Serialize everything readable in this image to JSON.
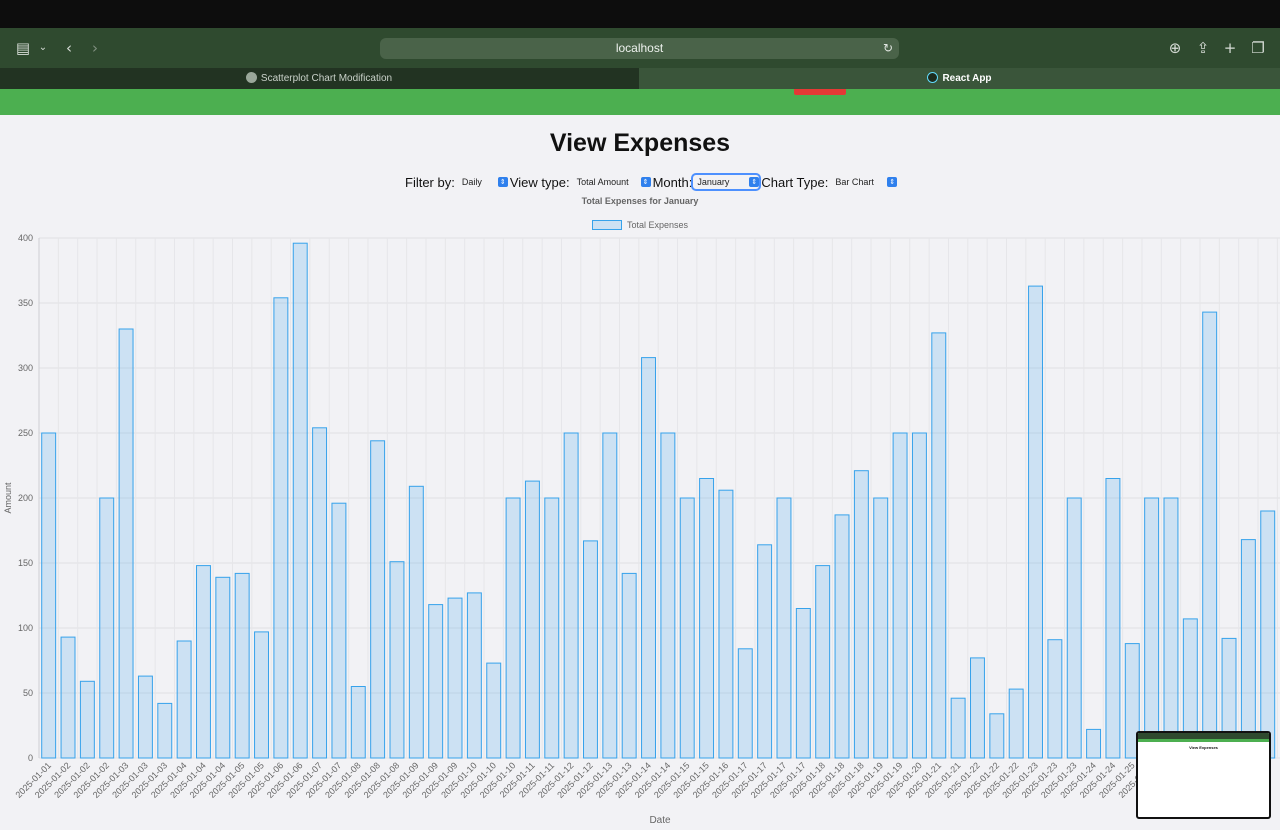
{
  "browser": {
    "url": "localhost",
    "tabs": [
      {
        "label": "Scatterplot Chart Modification",
        "active": false
      },
      {
        "label": "React App",
        "active": true
      }
    ]
  },
  "page": {
    "title": "View Expenses",
    "controls": {
      "filter_label": "Filter by:",
      "filter_value": "Daily",
      "view_label": "View type:",
      "view_value": "Total Amount",
      "month_label": "Month:",
      "month_value": "January",
      "chart_type_label": "Chart Type:",
      "chart_type_value": "Bar Chart"
    }
  },
  "chart_data": {
    "type": "bar",
    "title": "Total Expenses for January",
    "xlabel": "Date",
    "ylabel": "Amount",
    "ylim": [
      0,
      400
    ],
    "yticks": [
      0,
      50,
      100,
      150,
      200,
      250,
      300,
      350,
      400
    ],
    "grid": true,
    "legend_position": "top",
    "bar_color": "#36a2eb",
    "series": [
      {
        "name": "Total Expenses"
      }
    ],
    "categories": [
      "2025-01-01",
      "2025-01-02",
      "2025-01-02",
      "2025-01-02",
      "2025-01-03",
      "2025-01-03",
      "2025-01-03",
      "2025-01-04",
      "2025-01-04",
      "2025-01-04",
      "2025-01-05",
      "2025-01-05",
      "2025-01-06",
      "2025-01-06",
      "2025-01-07",
      "2025-01-07",
      "2025-01-08",
      "2025-01-08",
      "2025-01-08",
      "2025-01-09",
      "2025-01-09",
      "2025-01-09",
      "2025-01-10",
      "2025-01-10",
      "2025-01-10",
      "2025-01-11",
      "2025-01-11",
      "2025-01-12",
      "2025-01-12",
      "2025-01-13",
      "2025-01-13",
      "2025-01-14",
      "2025-01-14",
      "2025-01-15",
      "2025-01-15",
      "2025-01-16",
      "2025-01-17",
      "2025-01-17",
      "2025-01-17",
      "2025-01-17",
      "2025-01-18",
      "2025-01-18",
      "2025-01-18",
      "2025-01-19",
      "2025-01-19",
      "2025-01-20",
      "2025-01-21",
      "2025-01-21",
      "2025-01-22",
      "2025-01-22",
      "2025-01-22",
      "2025-01-23",
      "2025-01-23",
      "2025-01-23",
      "2025-01-24",
      "2025-01-24",
      "2025-01-25",
      "2025-01-26",
      "2025-01-27"
    ],
    "values": [
      250,
      93,
      59,
      200,
      330,
      63,
      42,
      90,
      148,
      139,
      142,
      97,
      354,
      396,
      254,
      196,
      55,
      244,
      151,
      209,
      118,
      123,
      127,
      73,
      200,
      213,
      200,
      250,
      167,
      250,
      142,
      308,
      250,
      200,
      215,
      206,
      84,
      164,
      200,
      115,
      148,
      187,
      221,
      200,
      250,
      250,
      327,
      46,
      77,
      34,
      53,
      363,
      91,
      200,
      22,
      215,
      88,
      200,
      200,
      107,
      343,
      92,
      168,
      190
    ]
  }
}
